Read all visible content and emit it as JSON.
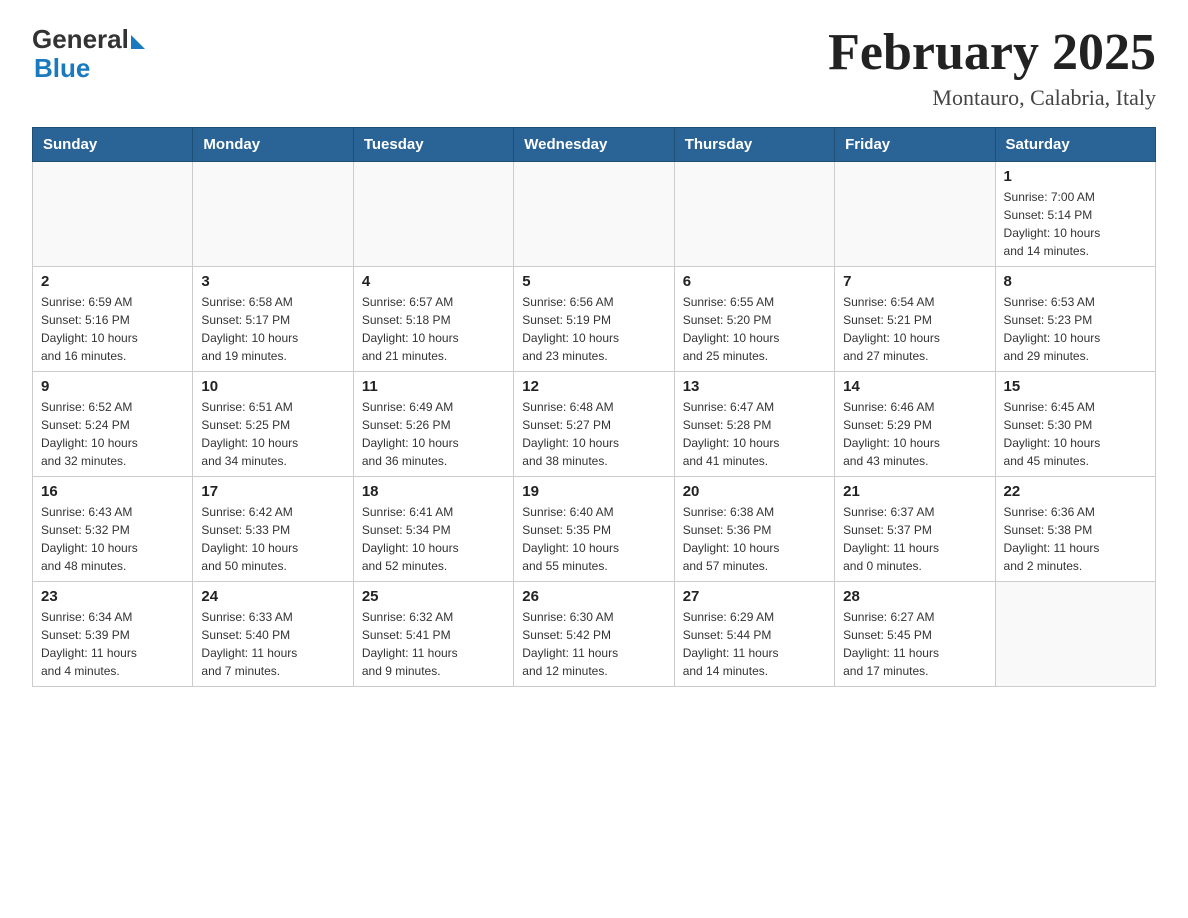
{
  "header": {
    "logo_general": "General",
    "logo_blue": "Blue",
    "title": "February 2025",
    "subtitle": "Montauro, Calabria, Italy"
  },
  "weekdays": [
    "Sunday",
    "Monday",
    "Tuesday",
    "Wednesday",
    "Thursday",
    "Friday",
    "Saturday"
  ],
  "weeks": [
    [
      {
        "day": "",
        "info": ""
      },
      {
        "day": "",
        "info": ""
      },
      {
        "day": "",
        "info": ""
      },
      {
        "day": "",
        "info": ""
      },
      {
        "day": "",
        "info": ""
      },
      {
        "day": "",
        "info": ""
      },
      {
        "day": "1",
        "info": "Sunrise: 7:00 AM\nSunset: 5:14 PM\nDaylight: 10 hours\nand 14 minutes."
      }
    ],
    [
      {
        "day": "2",
        "info": "Sunrise: 6:59 AM\nSunset: 5:16 PM\nDaylight: 10 hours\nand 16 minutes."
      },
      {
        "day": "3",
        "info": "Sunrise: 6:58 AM\nSunset: 5:17 PM\nDaylight: 10 hours\nand 19 minutes."
      },
      {
        "day": "4",
        "info": "Sunrise: 6:57 AM\nSunset: 5:18 PM\nDaylight: 10 hours\nand 21 minutes."
      },
      {
        "day": "5",
        "info": "Sunrise: 6:56 AM\nSunset: 5:19 PM\nDaylight: 10 hours\nand 23 minutes."
      },
      {
        "day": "6",
        "info": "Sunrise: 6:55 AM\nSunset: 5:20 PM\nDaylight: 10 hours\nand 25 minutes."
      },
      {
        "day": "7",
        "info": "Sunrise: 6:54 AM\nSunset: 5:21 PM\nDaylight: 10 hours\nand 27 minutes."
      },
      {
        "day": "8",
        "info": "Sunrise: 6:53 AM\nSunset: 5:23 PM\nDaylight: 10 hours\nand 29 minutes."
      }
    ],
    [
      {
        "day": "9",
        "info": "Sunrise: 6:52 AM\nSunset: 5:24 PM\nDaylight: 10 hours\nand 32 minutes."
      },
      {
        "day": "10",
        "info": "Sunrise: 6:51 AM\nSunset: 5:25 PM\nDaylight: 10 hours\nand 34 minutes."
      },
      {
        "day": "11",
        "info": "Sunrise: 6:49 AM\nSunset: 5:26 PM\nDaylight: 10 hours\nand 36 minutes."
      },
      {
        "day": "12",
        "info": "Sunrise: 6:48 AM\nSunset: 5:27 PM\nDaylight: 10 hours\nand 38 minutes."
      },
      {
        "day": "13",
        "info": "Sunrise: 6:47 AM\nSunset: 5:28 PM\nDaylight: 10 hours\nand 41 minutes."
      },
      {
        "day": "14",
        "info": "Sunrise: 6:46 AM\nSunset: 5:29 PM\nDaylight: 10 hours\nand 43 minutes."
      },
      {
        "day": "15",
        "info": "Sunrise: 6:45 AM\nSunset: 5:30 PM\nDaylight: 10 hours\nand 45 minutes."
      }
    ],
    [
      {
        "day": "16",
        "info": "Sunrise: 6:43 AM\nSunset: 5:32 PM\nDaylight: 10 hours\nand 48 minutes."
      },
      {
        "day": "17",
        "info": "Sunrise: 6:42 AM\nSunset: 5:33 PM\nDaylight: 10 hours\nand 50 minutes."
      },
      {
        "day": "18",
        "info": "Sunrise: 6:41 AM\nSunset: 5:34 PM\nDaylight: 10 hours\nand 52 minutes."
      },
      {
        "day": "19",
        "info": "Sunrise: 6:40 AM\nSunset: 5:35 PM\nDaylight: 10 hours\nand 55 minutes."
      },
      {
        "day": "20",
        "info": "Sunrise: 6:38 AM\nSunset: 5:36 PM\nDaylight: 10 hours\nand 57 minutes."
      },
      {
        "day": "21",
        "info": "Sunrise: 6:37 AM\nSunset: 5:37 PM\nDaylight: 11 hours\nand 0 minutes."
      },
      {
        "day": "22",
        "info": "Sunrise: 6:36 AM\nSunset: 5:38 PM\nDaylight: 11 hours\nand 2 minutes."
      }
    ],
    [
      {
        "day": "23",
        "info": "Sunrise: 6:34 AM\nSunset: 5:39 PM\nDaylight: 11 hours\nand 4 minutes."
      },
      {
        "day": "24",
        "info": "Sunrise: 6:33 AM\nSunset: 5:40 PM\nDaylight: 11 hours\nand 7 minutes."
      },
      {
        "day": "25",
        "info": "Sunrise: 6:32 AM\nSunset: 5:41 PM\nDaylight: 11 hours\nand 9 minutes."
      },
      {
        "day": "26",
        "info": "Sunrise: 6:30 AM\nSunset: 5:42 PM\nDaylight: 11 hours\nand 12 minutes."
      },
      {
        "day": "27",
        "info": "Sunrise: 6:29 AM\nSunset: 5:44 PM\nDaylight: 11 hours\nand 14 minutes."
      },
      {
        "day": "28",
        "info": "Sunrise: 6:27 AM\nSunset: 5:45 PM\nDaylight: 11 hours\nand 17 minutes."
      },
      {
        "day": "",
        "info": ""
      }
    ]
  ]
}
